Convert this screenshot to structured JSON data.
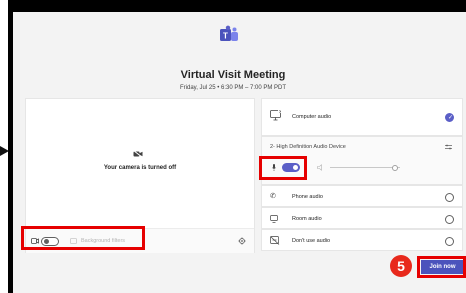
{
  "meeting": {
    "title": "Virtual Visit Meeting",
    "datetime": "Friday, Jul 25  •  6:30 PM  –  7:00 PM PDT"
  },
  "video": {
    "camera_off_text": "Your camera is turned off",
    "background_filters_label": "Background filters",
    "camera_toggle": "off"
  },
  "audio": {
    "computer_audio_label": "Computer audio",
    "device_label": "2- High Definition Audio Device",
    "mic_toggle": "on",
    "options": [
      {
        "label": "Phone audio"
      },
      {
        "label": "Room audio"
      },
      {
        "label": "Don't use audio"
      }
    ]
  },
  "join_label": "Join now",
  "step_badge": "5",
  "colors": {
    "accent": "#5b5fc7",
    "join": "#4b53bc",
    "highlight": "#e60000",
    "badge": "#e8291c"
  }
}
